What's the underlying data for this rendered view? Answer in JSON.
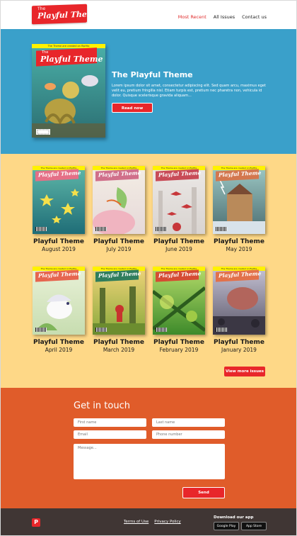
{
  "header": {
    "logo_small": "The",
    "logo_big": "Playful Theme",
    "nav": [
      "Most Recent",
      "All Issues",
      "Contact us"
    ]
  },
  "hero": {
    "cover_top": "The Theme are created on flipHtx",
    "cover_title": "Playful Theme",
    "cover_title_small": "The",
    "title": "The Playful Theme",
    "text": "Lorem ipsum dolor sit amet, consectetur adipiscing elit. Sed quam arcu, maximus eget velit eu, pretium fringilla nisl. Etiam turpis est, pretium nec pharetra non, vehicula id dolor. Quisque scelerisque gravida aliquam...",
    "button": "Read now"
  },
  "issues": [
    {
      "name": "Playful Theme",
      "date": "August 2019"
    },
    {
      "name": "Playful Theme",
      "date": "July 2019"
    },
    {
      "name": "Playful Theme",
      "date": "June 2019"
    },
    {
      "name": "Playful Theme",
      "date": "May 2019"
    },
    {
      "name": "Playful Theme",
      "date": "April 2019"
    },
    {
      "name": "Playful Theme",
      "date": "March 2019"
    },
    {
      "name": "Playful Theme",
      "date": "February 2019"
    },
    {
      "name": "Playful Theme",
      "date": "January 2019"
    }
  ],
  "cover_label": "Playful Theme",
  "cover_top": "The Theme are created on flipHtx",
  "more_button": "View more issues",
  "contact": {
    "title": "Get in touch",
    "first_name": "First name",
    "last_name": "Last name",
    "email": "Email",
    "phone": "Phone number",
    "message": "Message...",
    "send": "Send"
  },
  "footer": {
    "logo": "P",
    "terms": "Terms of Use",
    "privacy": "Privacy Policy",
    "download": "Download our app",
    "google": "Google Play",
    "apple": "App Store"
  },
  "colors": {
    "accent": "#e8262a",
    "hero_bg": "#3aa0ca",
    "issues_bg": "#fed887",
    "contact_bg": "#e05c2a",
    "footer_bg": "#403634"
  }
}
